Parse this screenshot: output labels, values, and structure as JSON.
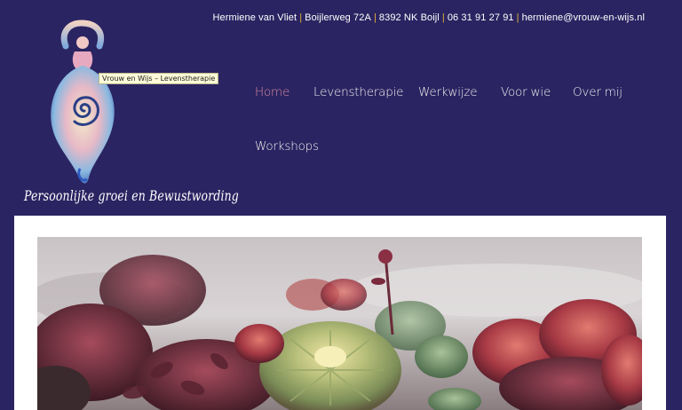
{
  "topbar": {
    "name": "Hermiene van Vliet",
    "address": "Boijlerweg 72A",
    "city": "8392 NK Boijl",
    "phone": "06 31 91 27 91",
    "email": "hermiene@vrouw-en-wijs.nl"
  },
  "logo": {
    "tooltip": "Vrouw en Wijs – Levenstherapie",
    "tagline": "Persoonlijke groei en Bewustwording"
  },
  "nav": {
    "items": [
      {
        "label": "Home",
        "active": true
      },
      {
        "label": "Levenstherapie",
        "active": false
      },
      {
        "label": "Werkwijze",
        "active": false
      },
      {
        "label": "Voor wie",
        "active": false
      },
      {
        "label": "Over mij",
        "active": false
      },
      {
        "label": "Workshops",
        "active": false
      }
    ]
  },
  "colors": {
    "background": "#2b2462",
    "accent_separator": "#e0b43a",
    "nav_active": "#d98aa0",
    "nav_text": "#f0f0f0"
  }
}
